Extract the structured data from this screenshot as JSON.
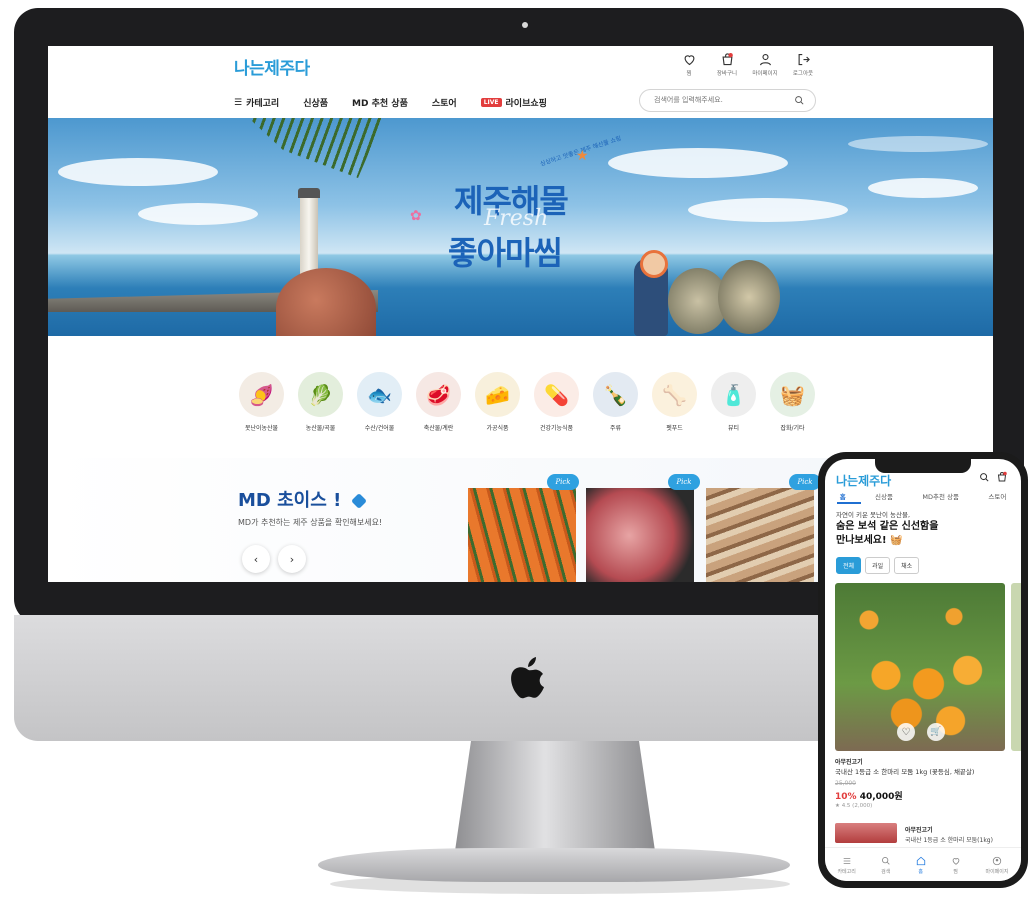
{
  "site": {
    "logo": "나는제주다",
    "header_icons": [
      {
        "icon": "heart-icon",
        "label": "찜"
      },
      {
        "icon": "cart-icon",
        "label": "장바구니"
      },
      {
        "icon": "user-icon",
        "label": "마이페이지"
      },
      {
        "icon": "logout-icon",
        "label": "로그아웃"
      }
    ],
    "nav": {
      "category": "카테고리",
      "new": "신상품",
      "md": "MD 추천 상품",
      "store": "스토어",
      "live_badge": "LIVE",
      "live": "라이브쇼핑"
    },
    "search": {
      "placeholder": "검색어를 입력해주세요."
    },
    "hero": {
      "line1": "제주해물",
      "fresh": "Fresh",
      "line2": "좋아마씸",
      "arc_text": "싱싱하고 맛좋은 제주 해산물 쇼핑"
    },
    "categories": [
      {
        "label": "못난이농산물",
        "icon": "🍠",
        "bg": "#f3ece4"
      },
      {
        "label": "농산물/곡물",
        "icon": "🥬",
        "bg": "#e3eedc"
      },
      {
        "label": "수산/건어물",
        "icon": "🐟",
        "bg": "#e2eef6"
      },
      {
        "label": "축산물/계란",
        "icon": "🥩",
        "bg": "#f6e8e4"
      },
      {
        "label": "가공식품",
        "icon": "🧀",
        "bg": "#f8f0dc"
      },
      {
        "label": "건강기능식품",
        "icon": "💊",
        "bg": "#fbece6"
      },
      {
        "label": "주류",
        "icon": "🍾",
        "bg": "#e3eaf2"
      },
      {
        "label": "펫푸드",
        "icon": "🦴",
        "bg": "#fbf1dd"
      },
      {
        "label": "뷰티",
        "icon": "🧴",
        "bg": "#eeeeee"
      },
      {
        "label": "잡화/기타",
        "icon": "🧺",
        "bg": "#e5f0e4"
      }
    ],
    "md_choice": {
      "title": "MD 초이스 !",
      "subtitle": "MD가 추천하는 제주 상품을 확인해보세요!",
      "prev": "‹",
      "next": "›",
      "pick_label": "Pick"
    }
  },
  "mobile": {
    "logo": "나는제주다",
    "tabs": [
      "홈",
      "신상품",
      "MD추천 상품",
      "스토어"
    ],
    "intro": "자연이 키운 못난이 농산물,",
    "headline_1": "숨은 보석 같은 신선함을",
    "headline_2": "만나보세요! 🧺",
    "chips": [
      "전체",
      "과일",
      "채소"
    ],
    "product": {
      "brand": "아무진고기",
      "name": "국내산 1등급 소 한마리 모둠 1kg (꽃등심, 채끝살)",
      "original_price": "25,000",
      "discount": "10%",
      "price": "40,000원",
      "rating": "4.5 (2,000)"
    },
    "product2": {
      "brand": "아무진고기",
      "name": "국내산 1등급 소 한마리 모둠(1kg)"
    },
    "bottom_nav": [
      "카테고리",
      "검색",
      "홈",
      "찜",
      "마이페이지"
    ]
  },
  "colors": {
    "brand": "#2a9cd8",
    "accent_navy": "#1a4f9c",
    "sale_red": "#e23d3d"
  }
}
